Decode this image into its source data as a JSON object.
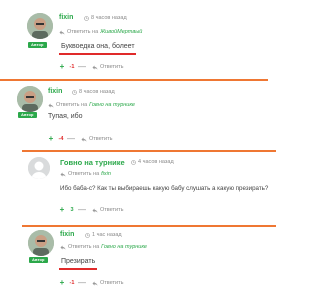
{
  "comments": [
    {
      "author": "fixin",
      "time": "8 часов назад",
      "reply_prefix": "Ответить на",
      "reply_to": "ЖивойМертвый",
      "badge": "Автор",
      "text": "Буквоедка она, болеет",
      "votes": "-1",
      "reply_label": "Ответить"
    },
    {
      "author": "fixin",
      "time": "8 часов назад",
      "reply_prefix": "Ответить на",
      "reply_to": "Говно на турнике",
      "badge": "Автор",
      "text": "Тупая, ибо",
      "votes": "-4",
      "reply_label": "Ответить"
    },
    {
      "author": "Говно на турнике",
      "time": "4 часов назад",
      "reply_prefix": "Ответить на",
      "reply_to": "fixin",
      "text": "Ибо баба-с? Как ты выбираешь какую бабу слушать а какую презирать?",
      "votes": "3",
      "reply_label": "Ответить"
    },
    {
      "author": "fixin",
      "time": "1 час назад",
      "reply_prefix": "Ответить на",
      "reply_to": "Говно на турнике",
      "badge": "Автор",
      "text": "Презирать",
      "votes": "-1",
      "reply_label": "Ответить"
    }
  ],
  "icons": {
    "clock": "clock-icon",
    "reply": "reply-arrow-icon",
    "plus": "+",
    "minus": "—"
  },
  "colors": {
    "accent_orange": "#ef7733",
    "author_green": "#2ba84a",
    "highlight_red": "#e02a2a",
    "muted": "#8a8a8a"
  }
}
